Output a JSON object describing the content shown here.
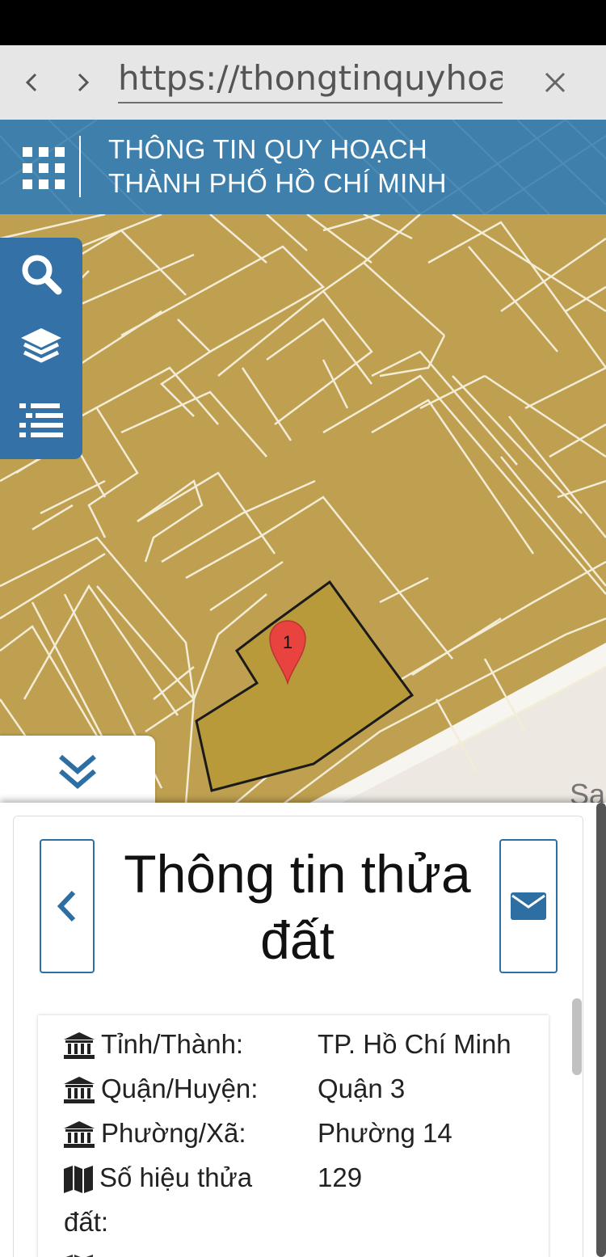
{
  "browser": {
    "url": "https://thongtinquyhoach.hochiminhcity.gov.vn",
    "back_icon": "chevron-left-icon",
    "forward_icon": "chevron-right-icon",
    "close_icon": "close-icon"
  },
  "header": {
    "title_line1": "THÔNG TIN QUY HOẠCH",
    "title_line2": "THÀNH PHỐ HỒ CHÍ MINH",
    "bg_color": "#3f7fab",
    "menu_icon": "apps-grid-icon"
  },
  "map": {
    "marker_label": "1",
    "street_label": "Sa",
    "parcel_color": "#bfa050",
    "selected_parcel_color": "#b89a3a"
  },
  "toolbar": {
    "items": [
      "search-icon",
      "layers-icon",
      "list-icon"
    ],
    "color": "#3471a6"
  },
  "panel": {
    "title": "Thông tin thửa đất",
    "rows": [
      {
        "label": "Tỉnh/Thành:",
        "value": "TP. Hồ Chí Minh",
        "icon": "bank-icon"
      },
      {
        "label": "Quận/Huyện:",
        "value": "Quận 3",
        "icon": "bank-icon"
      },
      {
        "label": "Phường/Xã:",
        "value": "Phường 14",
        "icon": "bank-icon"
      },
      {
        "label": "Số hiệu thửa",
        "label_cont": "đất:",
        "value": "129",
        "icon": "map-icon"
      }
    ]
  }
}
